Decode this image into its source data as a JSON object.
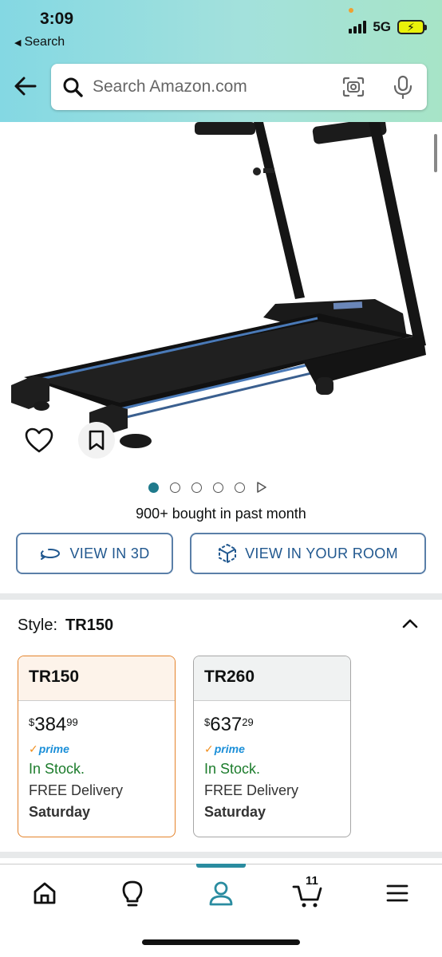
{
  "status_bar": {
    "time": "3:09",
    "back_label": "Search",
    "network": "5G"
  },
  "search": {
    "placeholder": "Search Amazon.com"
  },
  "product": {
    "bought_text": "900+ bought in past month",
    "image_count": 6
  },
  "buttons": {
    "view_3d": "VIEW IN 3D",
    "view_room": "VIEW IN YOUR ROOM"
  },
  "style": {
    "label": "Style:",
    "selected": "TR150"
  },
  "options": [
    {
      "name": "TR150",
      "price_symbol": "$",
      "price_whole": "384",
      "price_cents": "99",
      "prime": "prime",
      "stock": "In Stock.",
      "delivery": "FREE Delivery",
      "day": "Saturday",
      "selected": true
    },
    {
      "name": "TR260",
      "price_symbol": "$",
      "price_whole": "637",
      "price_cents": "29",
      "prime": "prime",
      "stock": "In Stock.",
      "delivery": "FREE Delivery",
      "day": "Saturday",
      "selected": false
    }
  ],
  "nav": {
    "items": [
      "home-icon",
      "lightbulb-icon",
      "account-icon",
      "cart-icon",
      "menu-icon"
    ],
    "cart_count": "11",
    "active": "account-icon"
  },
  "colors": {
    "accent": "#2a8ca0",
    "link": "#21588f",
    "in_stock": "#1c7c2c",
    "selected_border": "#e4832b",
    "prime_blue": "#1b8fd8"
  }
}
